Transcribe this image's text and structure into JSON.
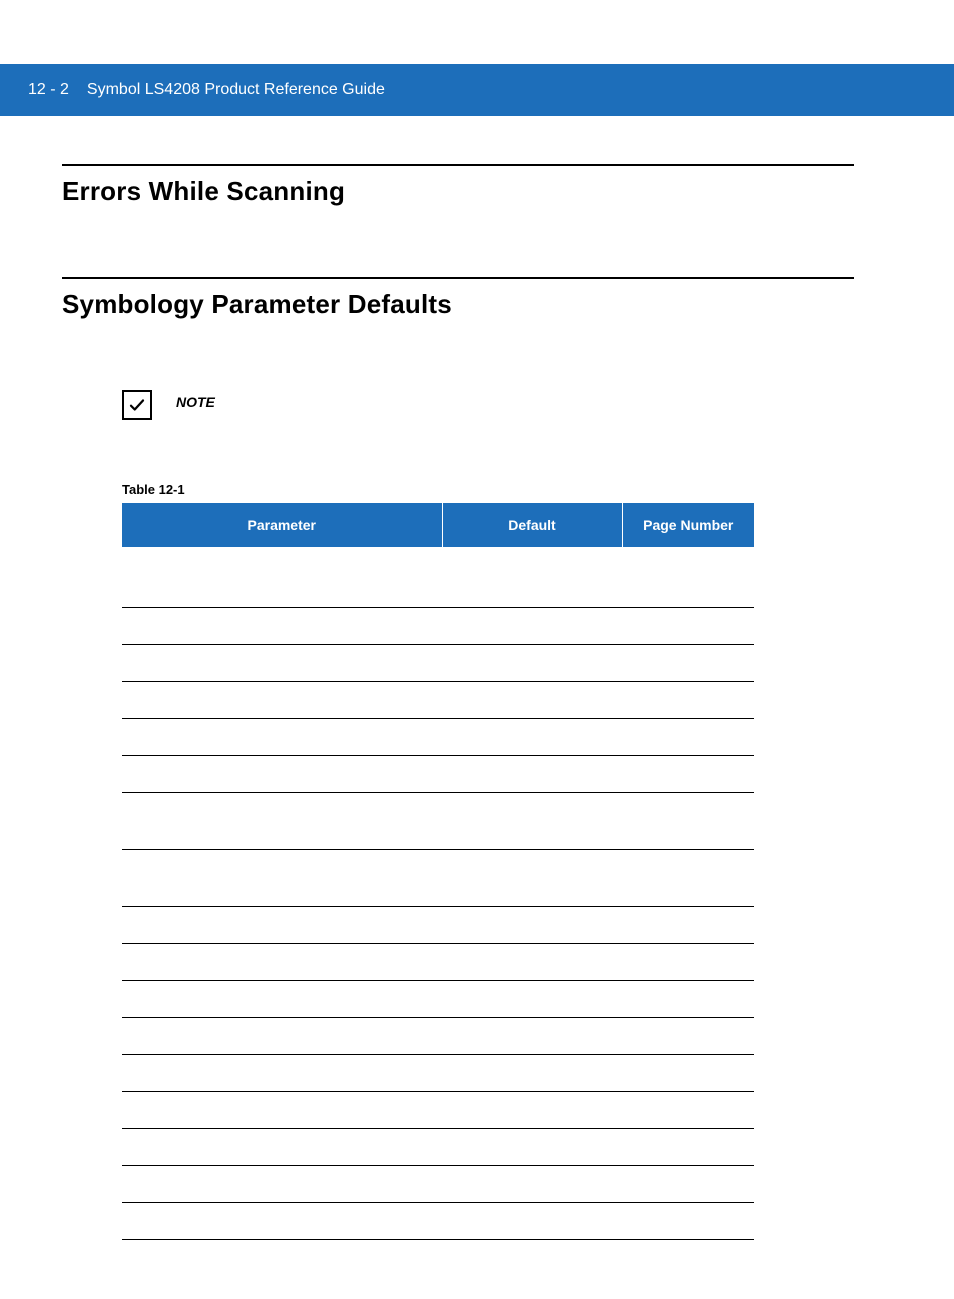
{
  "header": {
    "page_number": "12 - 2",
    "title": "Symbol LS4208 Product Reference Guide"
  },
  "sections": {
    "errors": {
      "title": "Errors While Scanning"
    },
    "defaults": {
      "title": "Symbology Parameter Defaults"
    }
  },
  "note": {
    "label": "NOTE"
  },
  "table": {
    "caption": "Table 12-1",
    "headers": {
      "parameter": "Parameter",
      "default": "Default",
      "page_number": "Page Number"
    },
    "rows": [
      {
        "parameter": "",
        "default": "",
        "page_number": "",
        "tall": false
      },
      {
        "parameter": "",
        "default": "",
        "page_number": "",
        "tall": false
      },
      {
        "parameter": "",
        "default": "",
        "page_number": "",
        "tall": false
      },
      {
        "parameter": "",
        "default": "",
        "page_number": "",
        "tall": false
      },
      {
        "parameter": "",
        "default": "",
        "page_number": "",
        "tall": false
      },
      {
        "parameter": "",
        "default": "",
        "page_number": "",
        "tall": false
      },
      {
        "parameter": "",
        "default": "",
        "page_number": "",
        "tall": true
      },
      {
        "parameter": "",
        "default": "",
        "page_number": "",
        "tall": true
      },
      {
        "parameter": "",
        "default": "",
        "page_number": "",
        "tall": false
      },
      {
        "parameter": "",
        "default": "",
        "page_number": "",
        "tall": false
      },
      {
        "parameter": "",
        "default": "",
        "page_number": "",
        "tall": false
      },
      {
        "parameter": "",
        "default": "",
        "page_number": "",
        "tall": false
      },
      {
        "parameter": "",
        "default": "",
        "page_number": "",
        "tall": false
      },
      {
        "parameter": "",
        "default": "",
        "page_number": "",
        "tall": false
      },
      {
        "parameter": "",
        "default": "",
        "page_number": "",
        "tall": false
      },
      {
        "parameter": "",
        "default": "",
        "page_number": "",
        "tall": false
      },
      {
        "parameter": "",
        "default": "",
        "page_number": "",
        "tall": false
      }
    ]
  }
}
